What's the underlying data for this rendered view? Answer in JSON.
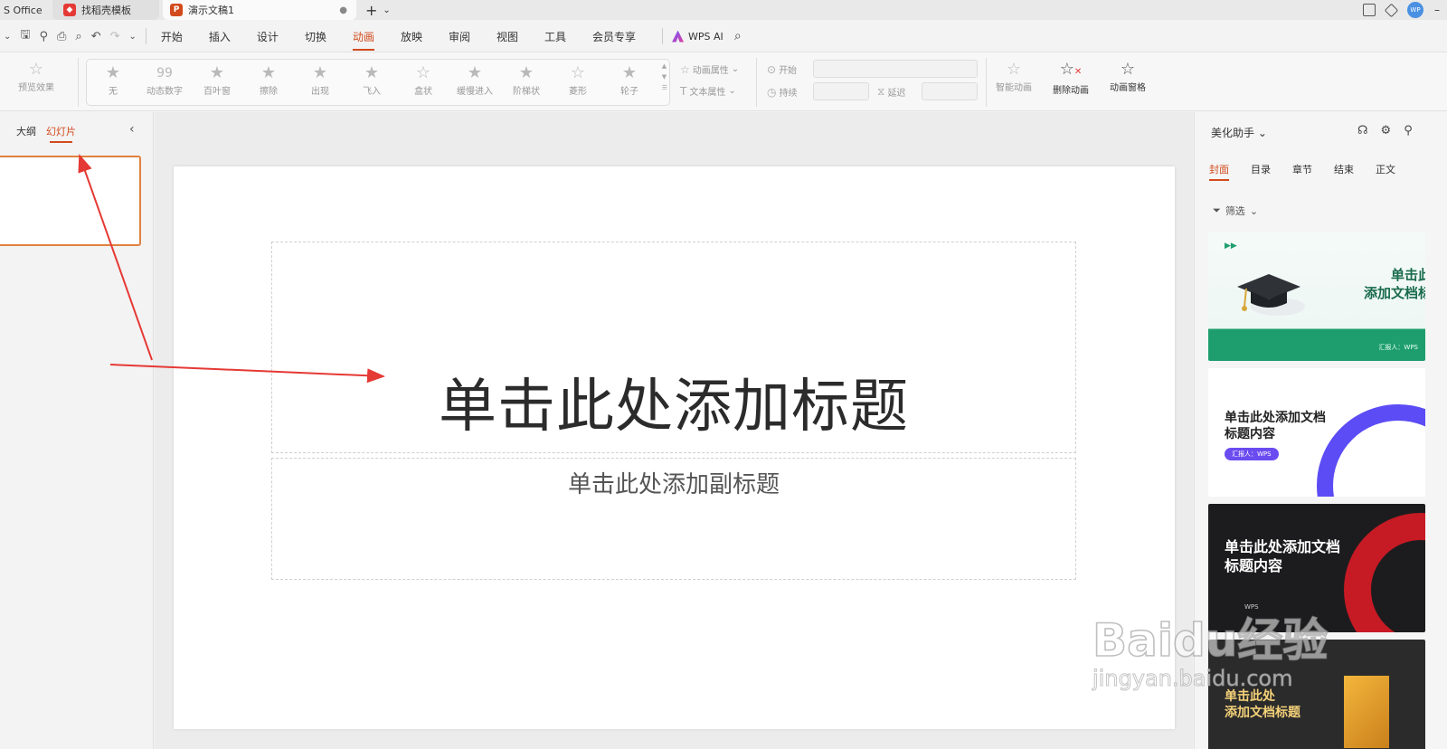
{
  "tabs": {
    "office": "S Office",
    "template": "找稻壳模板",
    "document": "演示文稿1"
  },
  "user_avatar": "WP",
  "menu": [
    "开始",
    "插入",
    "设计",
    "切换",
    "动画",
    "放映",
    "审阅",
    "视图",
    "工具",
    "会员专享"
  ],
  "active_menu": "动画",
  "wps_ai": "WPS AI",
  "ribbon": {
    "preview": "预览效果",
    "effects": [
      "无",
      "动态数字",
      "百叶窗",
      "擦除",
      "出现",
      "飞入",
      "盒状",
      "缓慢进入",
      "阶梯状",
      "菱形",
      "轮子"
    ],
    "anim_props": "动画属性",
    "text_props": "文本属性",
    "start": "开始",
    "duration": "持续",
    "delay": "延迟",
    "smart_anim": "智能动画",
    "delete_anim": "删除动画",
    "anim_pane": "动画窗格"
  },
  "left_panel": {
    "outline": "大纲",
    "slides": "幻灯片"
  },
  "slide": {
    "title": "单击此处添加标题",
    "subtitle": "单击此处添加副标题"
  },
  "right_panel": {
    "title": "美化助手",
    "tabs": [
      "封面",
      "目录",
      "章节",
      "结束",
      "正文"
    ],
    "filter": "筛选",
    "cards": [
      {
        "title": "单击此处\n添加文档标题",
        "small": "汇报人：WPS"
      },
      {
        "title": "单击此处添加文档\n标题内容",
        "small": "汇报人：WPS"
      },
      {
        "title": "单击此处添加文档\n标题内容",
        "small": "WPS"
      },
      {
        "title": "单击此处\n添加文档标题",
        "small": ""
      }
    ]
  },
  "watermark": {
    "main": "Baidu经验",
    "sub": "jingyan.baidu.com"
  },
  "colors": {
    "accent": "#d24a1c",
    "arrow": "#e53935",
    "selection": "#e0823f"
  }
}
